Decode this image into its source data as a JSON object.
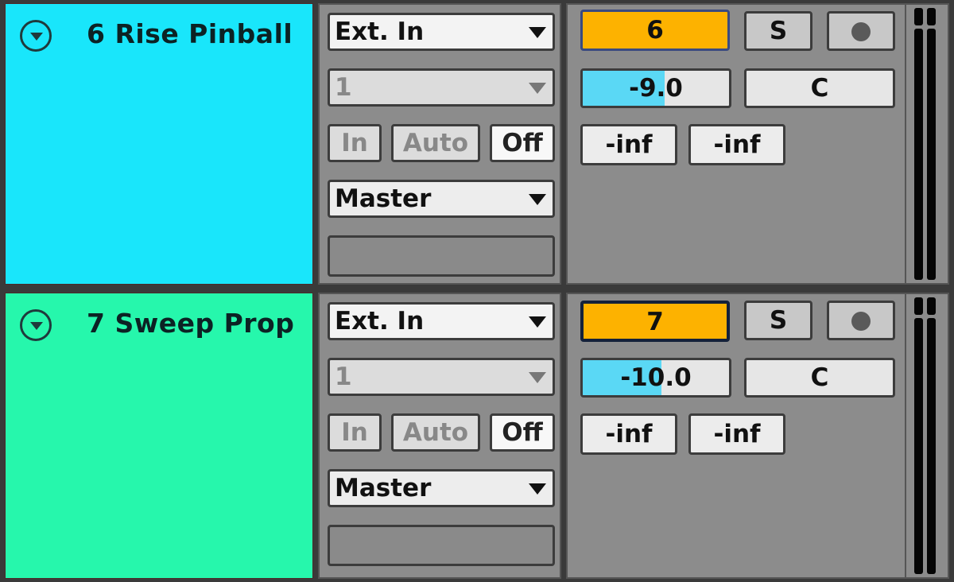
{
  "tracks": [
    {
      "name": "6 Rise Pinball",
      "color": "#19e6fb",
      "input_type": "Ext. In",
      "input_channel": "1",
      "monitor": {
        "in_label": "In",
        "auto_label": "Auto",
        "off_label": "Off",
        "selected": "Off"
      },
      "output": "Master",
      "activator_label": "6",
      "solo_label": "S",
      "arm_icon": "record-dot",
      "volume": {
        "label": "-9.0",
        "value_db": -9.0,
        "fill_fraction": 0.56
      },
      "pan_label": "C",
      "peak_left": "-inf",
      "peak_right": "-inf"
    },
    {
      "name": "7 Sweep Prop",
      "color": "#26f7ac",
      "input_type": "Ext. In",
      "input_channel": "1",
      "monitor": {
        "in_label": "In",
        "auto_label": "Auto",
        "off_label": "Off",
        "selected": "Off"
      },
      "output": "Master",
      "activator_label": "7",
      "solo_label": "S",
      "arm_icon": "record-dot",
      "volume": {
        "label": "-10.0",
        "value_db": -10.0,
        "fill_fraction": 0.54
      },
      "pan_label": "C",
      "peak_left": "-inf",
      "peak_right": "-inf"
    }
  ],
  "colors": {
    "activator_on": "#fdb200",
    "volume_fill": "#5ad8f5",
    "panel_bg": "#8c8c8c"
  }
}
